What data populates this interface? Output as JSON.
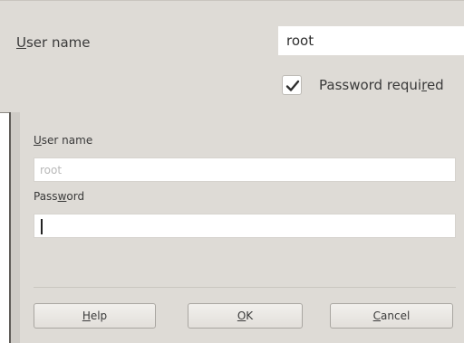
{
  "top_panel": {
    "user_name_label": "User name",
    "user_name_value": "root",
    "password_required_label": "Password required",
    "password_required_checked": true
  },
  "dialog": {
    "user_name_label": "User name",
    "user_name_value": "root",
    "password_label": "Password",
    "password_value": "",
    "buttons": {
      "help": "Help",
      "ok": "OK",
      "cancel": "Cancel"
    }
  }
}
